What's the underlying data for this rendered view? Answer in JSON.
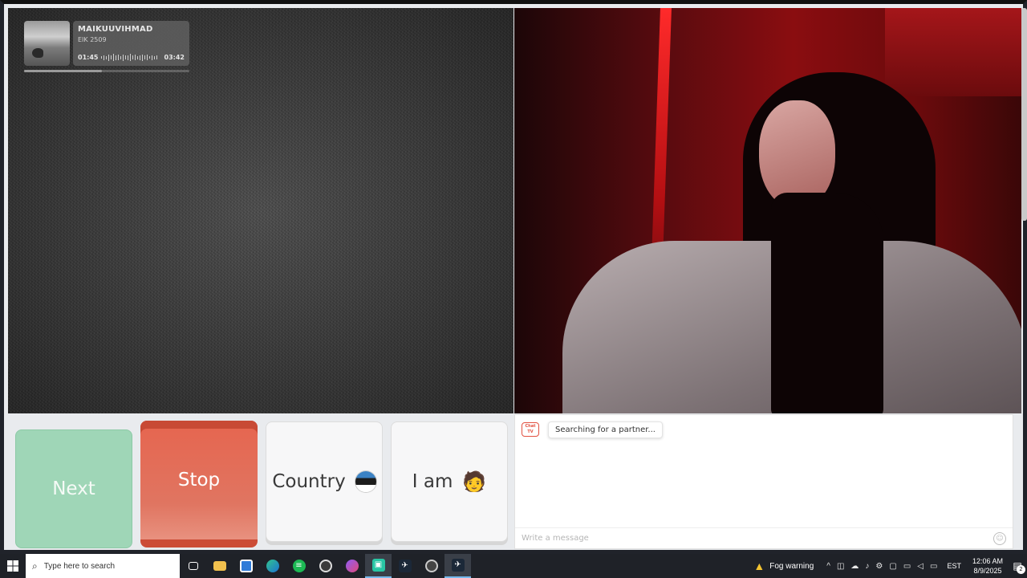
{
  "music": {
    "title": "MAIKUUVIHMAD",
    "artist": "EIK 2509",
    "time_current": "01:45",
    "time_total": "03:42",
    "progress_fraction": 0.47
  },
  "controls": {
    "next_label": "Next",
    "stop_label": "Stop",
    "country_label": "Country",
    "country_flag": "estonia-flag",
    "iam_label": "I am",
    "iam_emoji": "🧑"
  },
  "chat": {
    "logo_text": "Chat TV",
    "status_message": "Searching for a partner...",
    "input_placeholder": "Write a message"
  },
  "taskbar": {
    "search_placeholder": "Type here to search",
    "weather_text": "Fog warning",
    "language": "EST",
    "time": "12:06 AM",
    "date": "8/9/2025",
    "notification_count": "2",
    "pinned_apps": [
      "task-view",
      "file-explorer",
      "photos",
      "edge",
      "spotify",
      "obs",
      "messenger",
      "game-app",
      "steam",
      "chrome-like",
      "steam-alt"
    ]
  },
  "colors": {
    "next": "#9fd6b7",
    "stop": "#e6654f",
    "taskbar": "#1f2228"
  }
}
